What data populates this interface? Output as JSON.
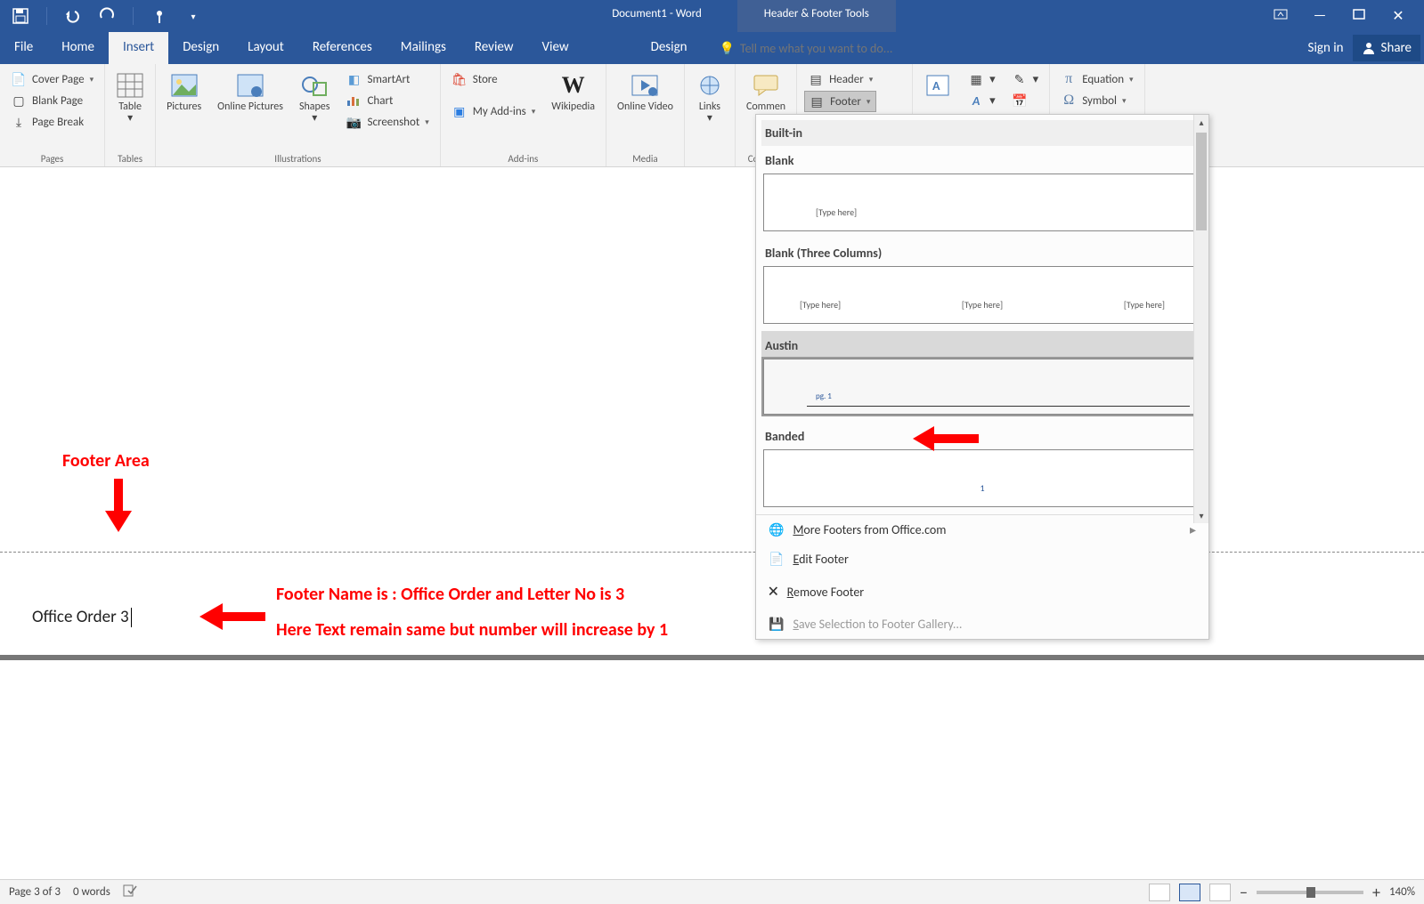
{
  "title": {
    "doc": "Document1 - Word",
    "context_tool": "Header & Footer Tools"
  },
  "window_controls": {
    "ribbon_opts": "▭",
    "min": "—",
    "max": "▢",
    "close": "✕"
  },
  "tabs": {
    "items": [
      "File",
      "Home",
      "Insert",
      "Design",
      "Layout",
      "References",
      "Mailings",
      "Review",
      "View"
    ],
    "context": "Design",
    "tellme_placeholder": "Tell me what you want to do...",
    "signin": "Sign in",
    "share": "Share"
  },
  "ribbon": {
    "pages": {
      "cover": "Cover Page",
      "blank": "Blank Page",
      "break": "Page Break",
      "label": "Pages"
    },
    "tables": {
      "table": "Table",
      "label": "Tables"
    },
    "illus": {
      "pictures": "Pictures",
      "online": "Online Pictures",
      "shapes": "Shapes",
      "smartart": "SmartArt",
      "chart": "Chart",
      "screenshot": "Screenshot",
      "label": "Illustrations"
    },
    "addins": {
      "store": "Store",
      "myaddins": "My Add-ins",
      "wikipedia": "Wikipedia",
      "label": "Add-ins"
    },
    "media": {
      "video": "Online Video",
      "label": "Media"
    },
    "links": {
      "links": "Links",
      "label": ""
    },
    "comments": {
      "comment": "Commen",
      "label": "Commen"
    },
    "hf": {
      "header": "Header",
      "footer": "Footer"
    },
    "symbols": {
      "equation": "Equation",
      "symbol": "Symbol"
    }
  },
  "gallery": {
    "section": "Built-in",
    "blank": {
      "title": "Blank",
      "placeholder": "[Type here]"
    },
    "blank3": {
      "title": "Blank (Three Columns)",
      "placeholder": "[Type here]"
    },
    "austin": {
      "title": "Austin",
      "pg": "pg. 1"
    },
    "banded": {
      "title": "Banded",
      "num": "1"
    },
    "more": "More Footers from Office.com",
    "edit": "Edit Footer",
    "remove": "Remove Footer",
    "save": "Save Selection to Footer Gallery..."
  },
  "document": {
    "footer_text": "Office Order  3"
  },
  "annotations": {
    "footer_area": "Footer Area",
    "line1": "Footer Name is : Office Order and Letter No is 3",
    "line2": "Here Text remain same but number will increase by 1"
  },
  "status": {
    "page": "Page 3 of 3",
    "words": "0 words",
    "zoom": "140%"
  }
}
